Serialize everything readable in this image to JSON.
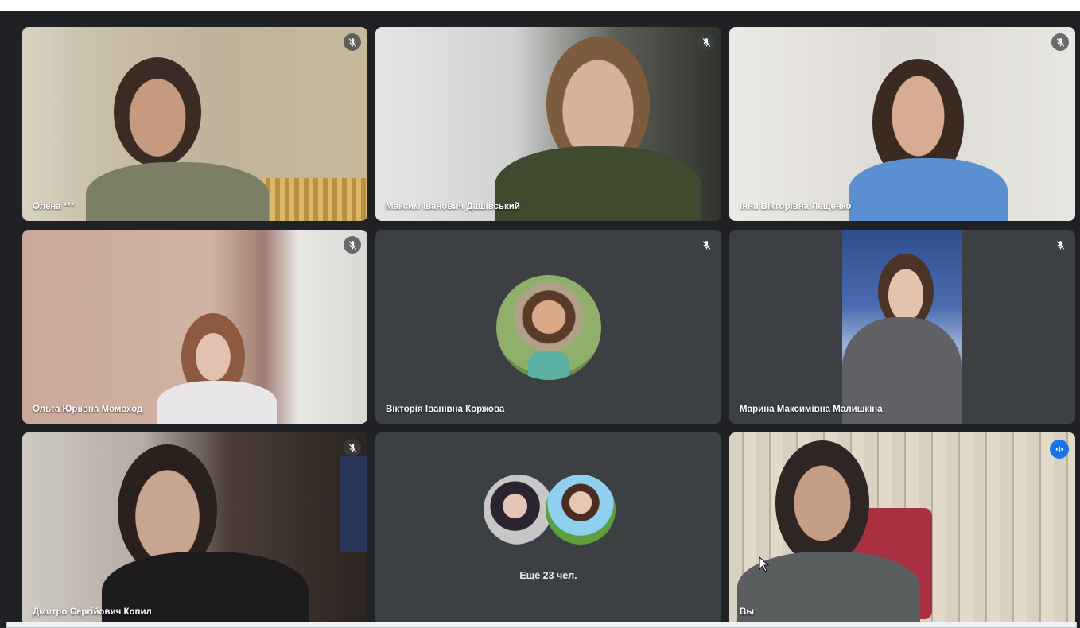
{
  "participants": [
    {
      "name": "Олена ***",
      "muted": true
    },
    {
      "name": "Максим Іванович Дашівський",
      "muted": true
    },
    {
      "name": "Інна Вікторівна Лещенко",
      "muted": true
    },
    {
      "name": "Ольга Юріївна Момоход",
      "muted": true
    },
    {
      "name": "Вікторія Іванівна Коржова",
      "muted": true
    },
    {
      "name": "Марина Максимівна Малишкіна",
      "muted": true
    },
    {
      "name": "Дмитро Сергійович Копил",
      "muted": true
    },
    {
      "more_label": "Ещё 23 чел."
    },
    {
      "name": "Вы",
      "speaking": true
    }
  ],
  "colors": {
    "background": "#202124",
    "tile": "#3c4043",
    "active_outline": "#8ab4f8",
    "speaking_badge": "#1a73e8"
  }
}
